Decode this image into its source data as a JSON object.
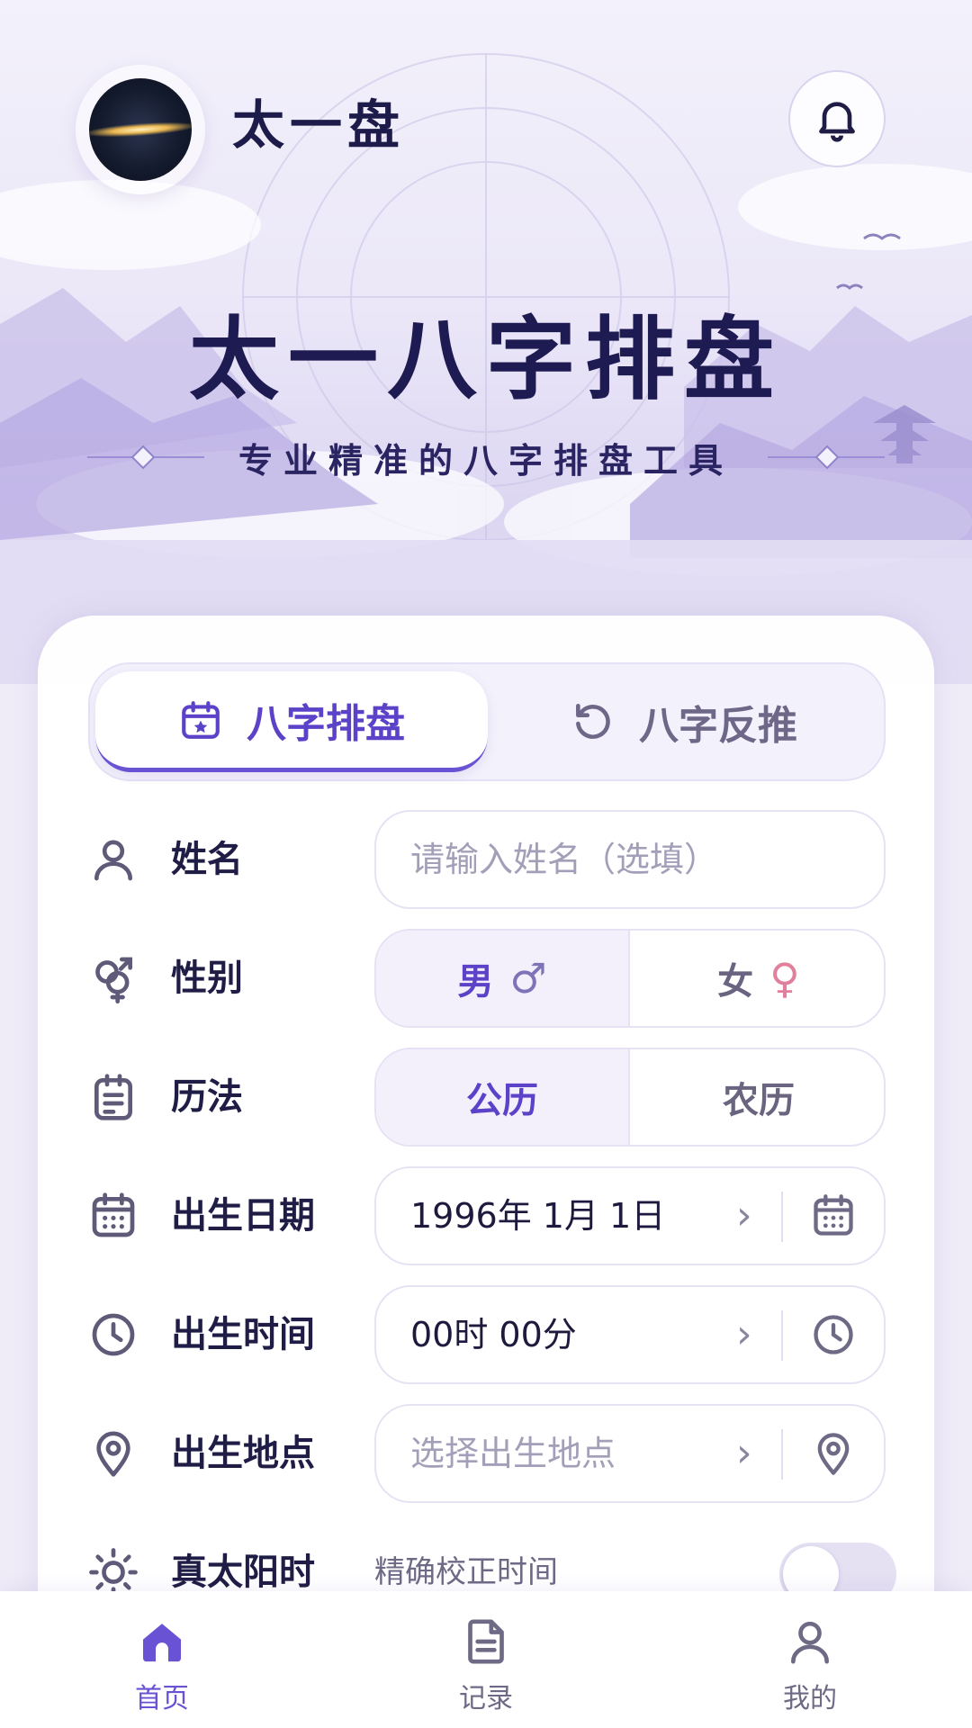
{
  "header": {
    "app_name": "太一盘",
    "logo_icon": "cosmic-logo-icon",
    "bell_icon": "bell-icon"
  },
  "hero": {
    "title": "太一八字排盘",
    "subtitle": "专业精准的八字排盘工具"
  },
  "tabs": [
    {
      "label": "八字排盘",
      "icon": "calendar-star-icon",
      "active": true
    },
    {
      "label": "八字反推",
      "icon": "rotate-ccw-icon",
      "active": false
    }
  ],
  "form": {
    "name": {
      "label": "姓名",
      "placeholder": "请输入姓名（选填）",
      "icon": "user-icon"
    },
    "gender": {
      "label": "性别",
      "icon": "gender-icon",
      "options": [
        "男",
        "女"
      ],
      "selected": "男",
      "male_symbol": "♂",
      "female_symbol": "♀"
    },
    "calendar": {
      "label": "历法",
      "icon": "clipboard-list-icon",
      "options": [
        "公历",
        "农历"
      ],
      "selected": "公历"
    },
    "birth_date": {
      "label": "出生日期",
      "value": "1996年 1月 1日",
      "chevron": "›",
      "icon": "calendar-icon"
    },
    "birth_time": {
      "label": "出生时间",
      "value": "00时 00分",
      "chevron": "›",
      "icon": "clock-icon"
    },
    "birth_place": {
      "label": "出生地点",
      "placeholder": "选择出生地点",
      "chevron": "›",
      "icon": "map-pin-icon"
    },
    "true_solar_time": {
      "label": "真太阳时",
      "description": "精确校正时间",
      "icon": "sun-icon",
      "enabled": false
    }
  },
  "bottom_nav": [
    {
      "label": "首页",
      "icon": "home-icon",
      "active": true
    },
    {
      "label": "记录",
      "icon": "document-icon",
      "active": false
    },
    {
      "label": "我的",
      "icon": "profile-icon",
      "active": false
    }
  ],
  "colors": {
    "accent": "#6a52d4",
    "title": "#1e1a52",
    "background": "#efecf8"
  }
}
